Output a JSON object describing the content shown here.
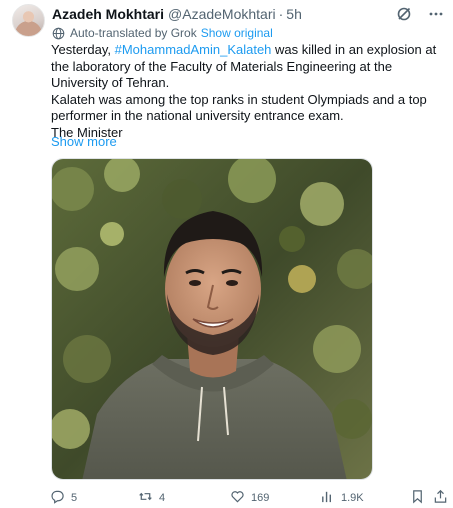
{
  "author": {
    "display_name": "Azadeh Mokhtari",
    "handle": "@AzadeMokhtari",
    "separator": "·",
    "time": "5h"
  },
  "translation": {
    "label": "Auto-translated by Grok",
    "show_original": "Show original"
  },
  "post": {
    "line1_prefix": "Yesterday, ",
    "hashtag": "#MohammadAmin_Kalateh",
    "line1_suffix": " was killed in an explosion at the laboratory of the Faculty of Materials Engineering at the University of Tehran.",
    "paragraph2": "Kalateh was among the top ranks in student Olympiads and a top performer in the national university entrance exam.",
    "paragraph3": "The Minister",
    "show_more": "Show more"
  },
  "engagement": {
    "replies": "5",
    "reposts": "4",
    "likes": "169",
    "views": "1.9K"
  },
  "icons": {
    "header": [
      "grok-icon",
      "more-icon"
    ],
    "actions": [
      "reply-icon",
      "repost-icon",
      "like-icon",
      "views-icon",
      "bookmark-icon",
      "share-icon"
    ]
  },
  "colors": {
    "accent": "#1d9bf0",
    "secondary_text": "#536471",
    "primary_text": "#0f1419"
  }
}
